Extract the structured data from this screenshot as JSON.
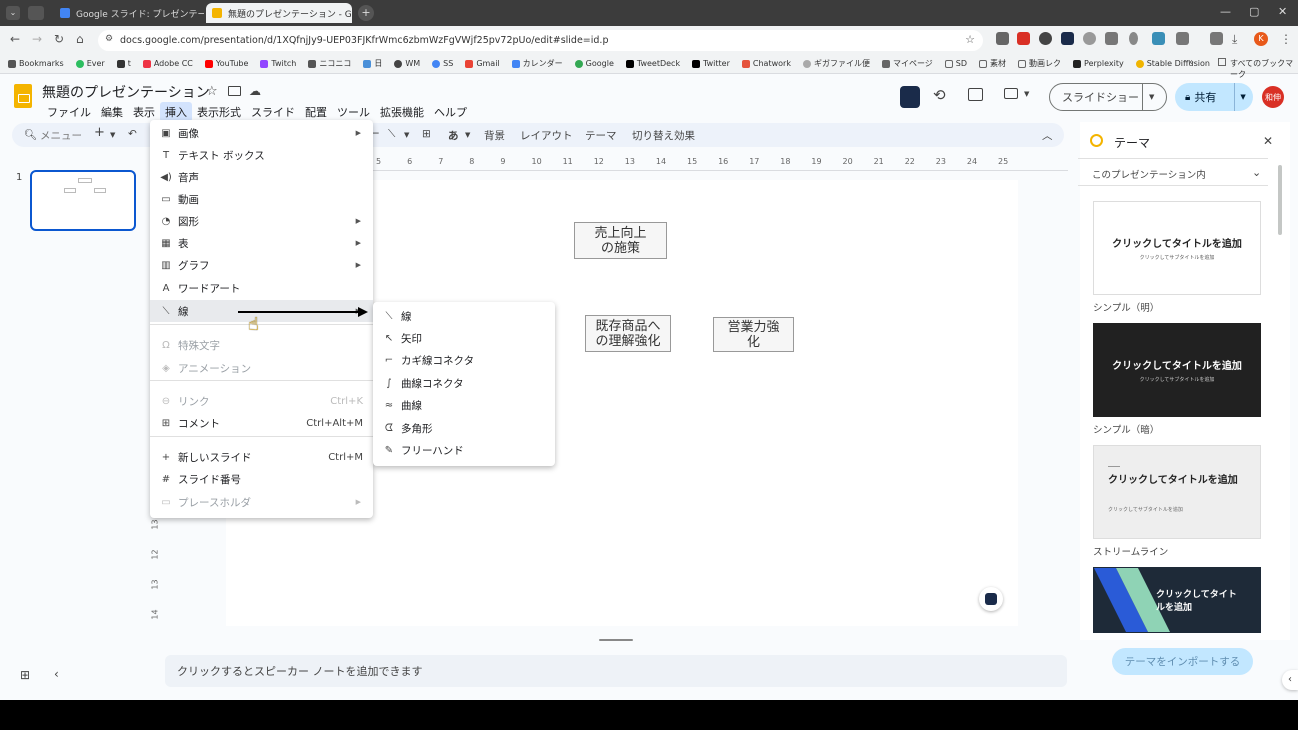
{
  "browser": {
    "tabs": [
      {
        "label": "Google スライド: プレゼンテーション",
        "active": false
      },
      {
        "label": "無題のプレゼンテーション - Google",
        "active": true
      }
    ],
    "url": "docs.google.com/presentation/d/1XQfnjJy9-UEP03FJKfrWmc6zbmWzFgVWjf25pv72pUo/edit#slide=id.p",
    "bookmarks": [
      "Bookmarks",
      "Ever",
      "t",
      "Adobe CC",
      "YouTube",
      "Twitch",
      "ニコニコ",
      "日",
      "WM",
      "SS",
      "Gmail",
      "カレンダー",
      "Google",
      "TweetDeck",
      "Twitter",
      "Chatwork",
      "ギガファイル便",
      "マイページ",
      "SD",
      "素材",
      "動画レク",
      "Perplexity",
      "Stable Diffusion"
    ],
    "all_bookmarks": "すべてのブックマーク",
    "profile_initial": "K",
    "overflow": "»"
  },
  "doc": {
    "title": "無題のプレゼンテーション",
    "menus": [
      "ファイル",
      "編集",
      "表示",
      "挿入",
      "表示形式",
      "スライド",
      "配置",
      "ツール",
      "拡張機能",
      "ヘルプ"
    ],
    "slideshow_label": "スライドショー",
    "share_label": "共有",
    "avatar_text": "和伸"
  },
  "toolbar": {
    "search_placeholder": "メニュー",
    "background": "背景",
    "layout": "レイアウト",
    "theme": "テーマ",
    "transition": "切り替え効果",
    "text_glyph": "あ"
  },
  "ruler": [
    "5",
    "6",
    "7",
    "8",
    "9",
    "10",
    "11",
    "12",
    "13",
    "14",
    "15",
    "16",
    "17",
    "18",
    "19",
    "20",
    "21",
    "22",
    "23",
    "24",
    "25"
  ],
  "ruler_v": [
    "13",
    "12",
    "13",
    "14"
  ],
  "filmstrip": {
    "slide_number": "1"
  },
  "slide": {
    "boxes": [
      {
        "text": "売上向上の施策",
        "line1": "売上向上",
        "line2": "の施策"
      },
      {
        "text": "既存商品への理解強化",
        "line1": "既存商品へ",
        "line2": "の理解強化"
      },
      {
        "text": "営業力強化",
        "line1": "営業力強",
        "line2": "化"
      }
    ]
  },
  "insert_menu": {
    "items": [
      {
        "label": "画像",
        "icon": "image-icon",
        "glyph": "▣",
        "submenu": true
      },
      {
        "label": "テキスト ボックス",
        "icon": "textbox-icon",
        "glyph": "T"
      },
      {
        "label": "音声",
        "icon": "audio-icon",
        "glyph": "◀)"
      },
      {
        "label": "動画",
        "icon": "video-icon",
        "glyph": "▭"
      },
      {
        "label": "図形",
        "icon": "shape-icon",
        "glyph": "◔",
        "submenu": true
      },
      {
        "label": "表",
        "icon": "table-icon",
        "glyph": "▦",
        "submenu": true
      },
      {
        "label": "グラフ",
        "icon": "chart-icon",
        "glyph": "▥",
        "submenu": true
      },
      {
        "label": "ワードアート",
        "icon": "wordart-icon",
        "glyph": "A"
      },
      {
        "label": "線",
        "icon": "line-icon",
        "glyph": "⟍",
        "submenu": true,
        "highlighted": true
      },
      {
        "label": "特殊文字",
        "icon": "omega-icon",
        "glyph": "Ω",
        "disabled": true
      },
      {
        "label": "アニメーション",
        "icon": "animation-icon",
        "glyph": "◈",
        "disabled": true
      },
      {
        "label": "リンク",
        "icon": "link-icon",
        "glyph": "⊖",
        "disabled": true,
        "shortcut": "Ctrl+K"
      },
      {
        "label": "コメント",
        "icon": "comment-icon",
        "glyph": "⊞",
        "shortcut": "Ctrl+Alt+M"
      },
      {
        "label": "新しいスライド",
        "icon": "plus-icon",
        "glyph": "+",
        "shortcut": "Ctrl+M"
      },
      {
        "label": "スライド番号",
        "icon": "hash-icon",
        "glyph": "#"
      },
      {
        "label": "プレースホルダ",
        "icon": "placeholder-icon",
        "glyph": "▭",
        "disabled": true,
        "submenu": true
      }
    ]
  },
  "line_submenu": {
    "items": [
      {
        "label": "線",
        "icon": "line-icon",
        "glyph": "⟍"
      },
      {
        "label": "矢印",
        "icon": "arrow-icon",
        "glyph": "↖"
      },
      {
        "label": "カギ線コネクタ",
        "icon": "elbow-connector-icon",
        "glyph": "⌐"
      },
      {
        "label": "曲線コネクタ",
        "icon": "curved-connector-icon",
        "glyph": "∫"
      },
      {
        "label": "曲線",
        "icon": "curve-icon",
        "glyph": "≈"
      },
      {
        "label": "多角形",
        "icon": "polygon-icon",
        "glyph": "ᗧ"
      },
      {
        "label": "フリーハンド",
        "icon": "freehand-icon",
        "glyph": "✎"
      }
    ]
  },
  "theme_panel": {
    "title": "テーマ",
    "scope": "このプレゼンテーション内",
    "themes": [
      {
        "name": "シンプル（明）",
        "card_title": "クリックしてタイトルを追加",
        "card_sub": "クリックしてサブタイトルを追加",
        "style": "light"
      },
      {
        "name": "シンプル（暗）",
        "card_title": "クリックしてタイトルを追加",
        "card_sub": "クリックしてサブタイトルを追加",
        "style": "dark"
      },
      {
        "name": "ストリームライン",
        "card_title": "クリックしてタイトルを追加",
        "card_sub": "クリックしてサブタイトルを追加",
        "style": "stream"
      },
      {
        "name": "",
        "card_title": "クリックしてタイトルを追加",
        "card_sub": "",
        "style": "focus"
      }
    ],
    "import_label": "テーマをインポートする"
  },
  "notes_placeholder": "クリックするとスピーカー ノートを追加できます",
  "colors": {
    "accent": "#0b57d0",
    "share_bg": "#c2e7ff",
    "logo": "#f4b400"
  }
}
